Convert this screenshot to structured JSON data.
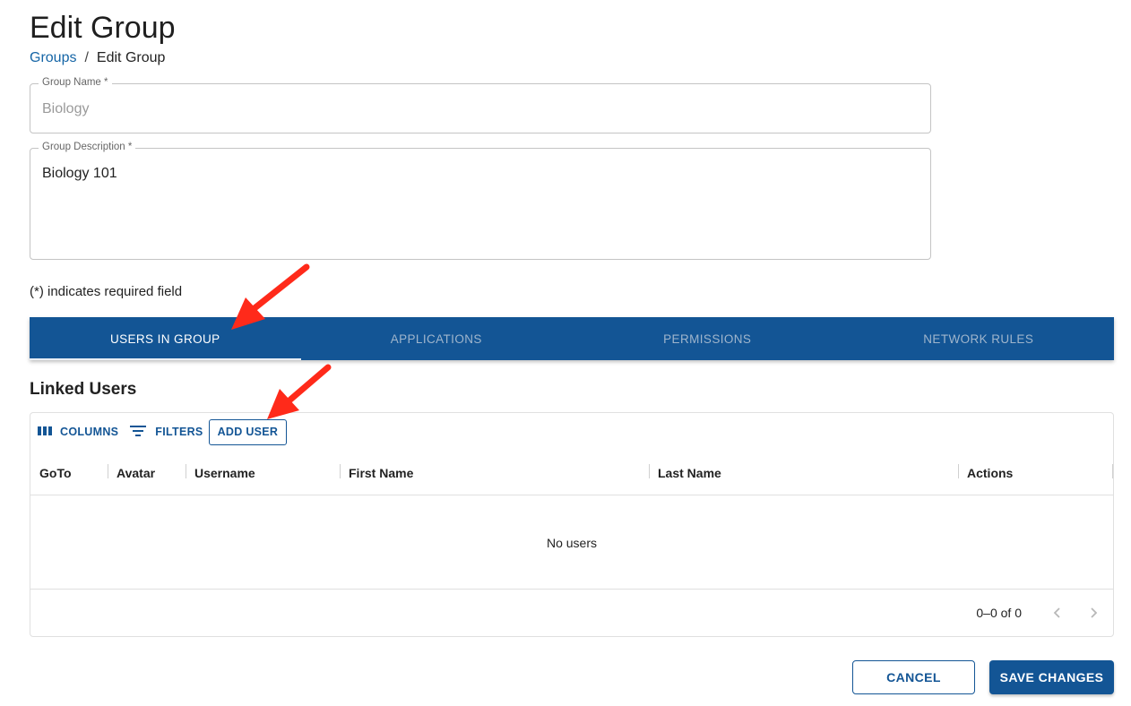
{
  "page": {
    "title": "Edit Group",
    "breadcrumb": {
      "link": "Groups",
      "separator": "/",
      "current": "Edit Group"
    }
  },
  "form": {
    "group_name": {
      "label": "Group Name *",
      "value": "Biology"
    },
    "group_description": {
      "label": "Group Description *",
      "value": "Biology 101"
    },
    "required_note": "(*) indicates required field"
  },
  "tabs": [
    {
      "label": "USERS IN GROUP",
      "active": true
    },
    {
      "label": "APPLICATIONS",
      "active": false
    },
    {
      "label": "PERMISSIONS",
      "active": false
    },
    {
      "label": "NETWORK RULES",
      "active": false
    }
  ],
  "linked_users": {
    "title": "Linked Users",
    "toolbar": {
      "columns_label": "COLUMNS",
      "filters_label": "FILTERS",
      "add_user_label": "ADD USER"
    },
    "columns": [
      "GoTo",
      "Avatar",
      "Username",
      "First Name",
      "Last Name",
      "Actions"
    ],
    "empty_message": "No users",
    "pagination": {
      "text": "0–0 of 0"
    }
  },
  "actions": {
    "cancel_label": "CANCEL",
    "save_label": "SAVE CHANGES"
  },
  "colors": {
    "primary": "#135595",
    "link": "#1565a6",
    "annotation_arrow": "#ff2a1a"
  },
  "icons": [
    "columns-icon",
    "filter-icon",
    "chevron-left-icon",
    "chevron-right-icon"
  ]
}
